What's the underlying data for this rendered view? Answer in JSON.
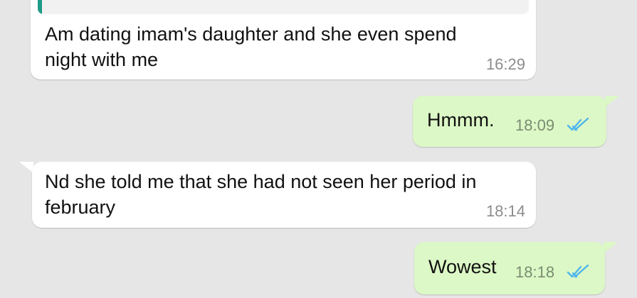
{
  "colors": {
    "background": "#e6e6e6",
    "incoming_bubble": "#ffffff",
    "outgoing_bubble": "#dcf8c6",
    "read_ticks": "#4fb6ec",
    "quote_accent": "#1e9b87"
  },
  "messages": [
    {
      "direction": "incoming",
      "quoted_preview": "...",
      "text": "Am dating imam's daughter and she even spend\nnight with me",
      "time": "16:29"
    },
    {
      "direction": "outgoing",
      "text": "Hmmm.",
      "time": "18:09",
      "status_icon": "double-check-read-icon"
    },
    {
      "direction": "incoming",
      "text": "Nd she told me that she had not seen her period in\nfebruary",
      "time": "18:14"
    },
    {
      "direction": "outgoing",
      "text": "Wowest",
      "time": "18:18",
      "status_icon": "double-check-read-icon"
    }
  ]
}
